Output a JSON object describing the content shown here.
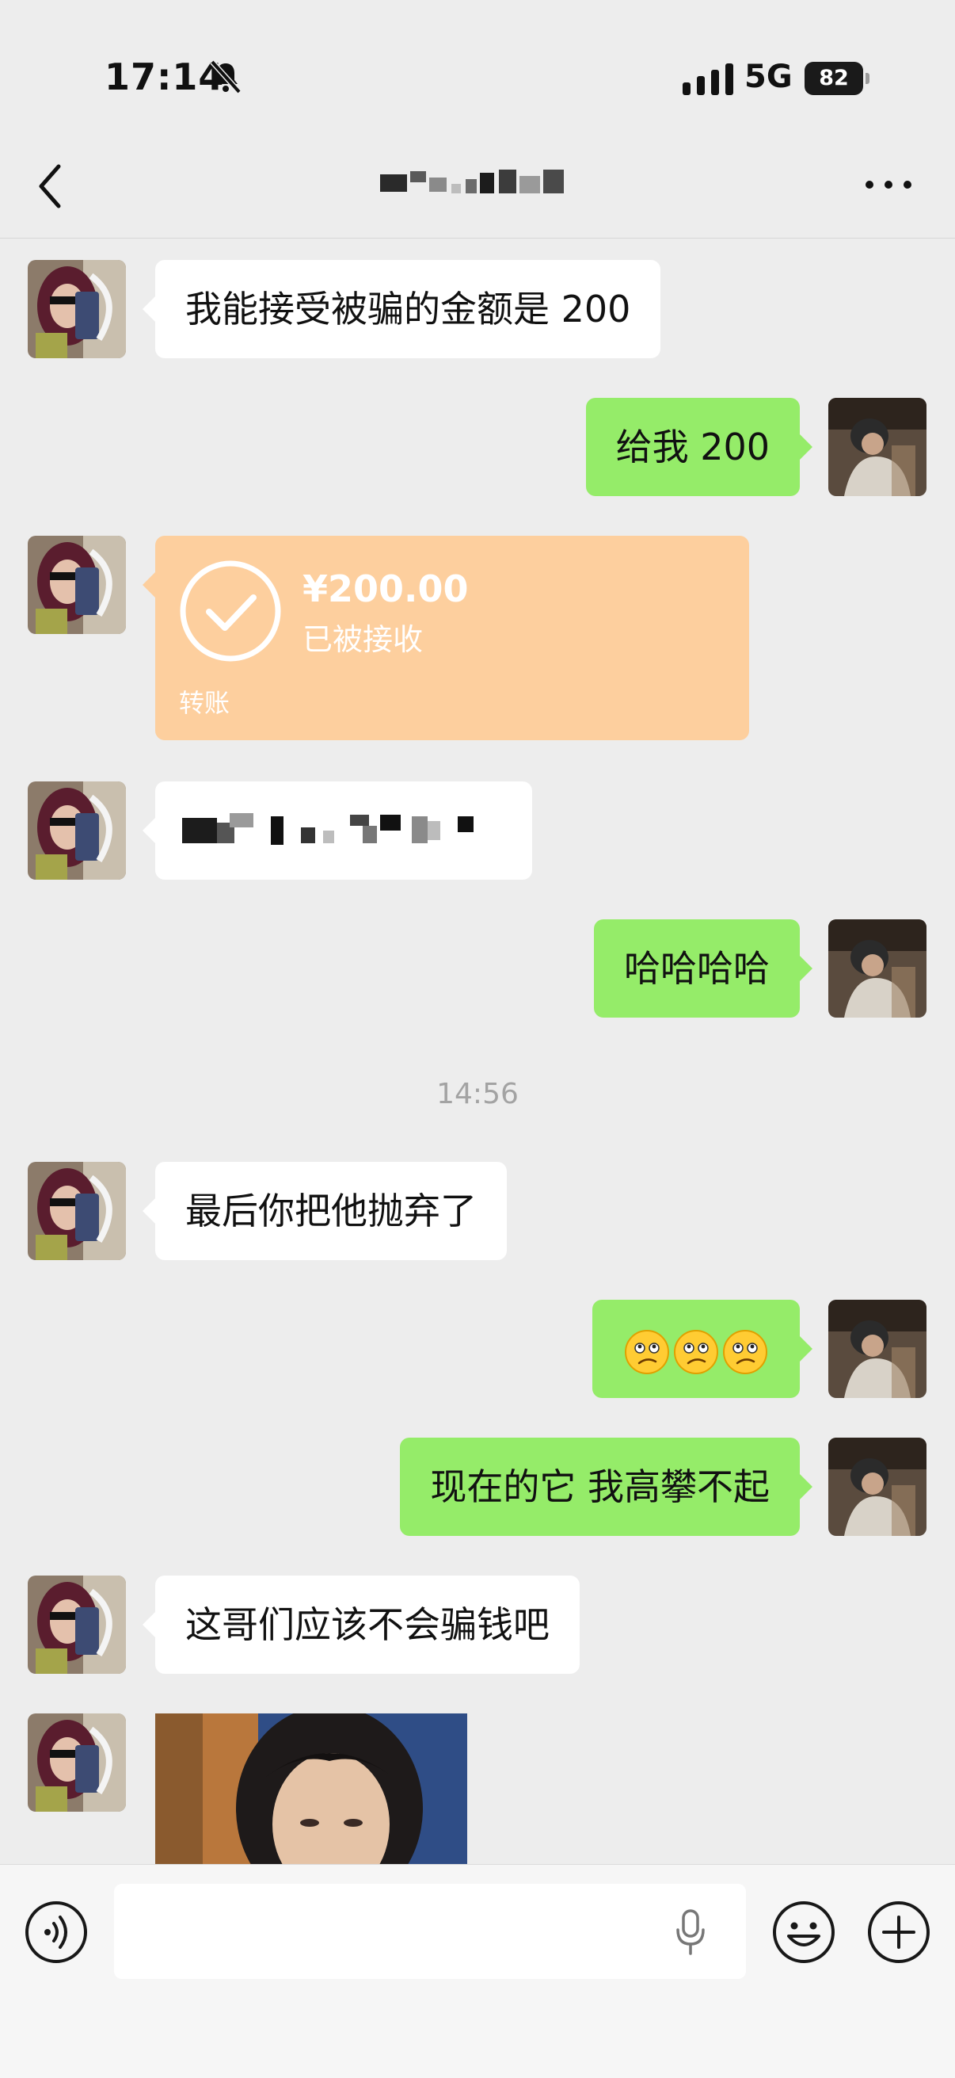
{
  "status_bar": {
    "time": "17:14",
    "network": "5G",
    "battery": "82"
  },
  "header": {
    "back_icon": "chevron-left-icon",
    "title_redacted": true,
    "more_icon": "more-dots-icon"
  },
  "messages": [
    {
      "side": "left",
      "type": "text",
      "text": "我能接受被骗的金额是 200"
    },
    {
      "side": "right",
      "type": "text",
      "text": "给我 200"
    },
    {
      "side": "left",
      "type": "transfer",
      "amount": "¥200.00",
      "status": "已被接收",
      "label": "转账"
    },
    {
      "side": "left",
      "type": "text-redacted"
    },
    {
      "side": "right",
      "type": "text",
      "text": "哈哈哈哈"
    },
    {
      "type": "timestamp",
      "text": "14:56"
    },
    {
      "side": "left",
      "type": "text",
      "text": "最后你把他抛弃了"
    },
    {
      "side": "right",
      "type": "emoji",
      "emoji": [
        "confused-face-icon",
        "confused-face-icon",
        "confused-face-icon"
      ]
    },
    {
      "side": "right",
      "type": "text",
      "text": "现在的它 我高攀不起"
    },
    {
      "side": "left",
      "type": "text",
      "text": "这哥们应该不会骗钱吧"
    },
    {
      "side": "left",
      "type": "image",
      "image": "photo-woman"
    }
  ],
  "input_bar": {
    "voice_icon": "voice-wave-icon",
    "mic_icon": "microphone-icon",
    "emoji_icon": "smile-icon",
    "plus_icon": "plus-circle-icon",
    "placeholder": ""
  },
  "colors": {
    "background": "#ededed",
    "outgoing": "#95ec69",
    "incoming": "#ffffff",
    "transfer": "#fdcf9e"
  }
}
